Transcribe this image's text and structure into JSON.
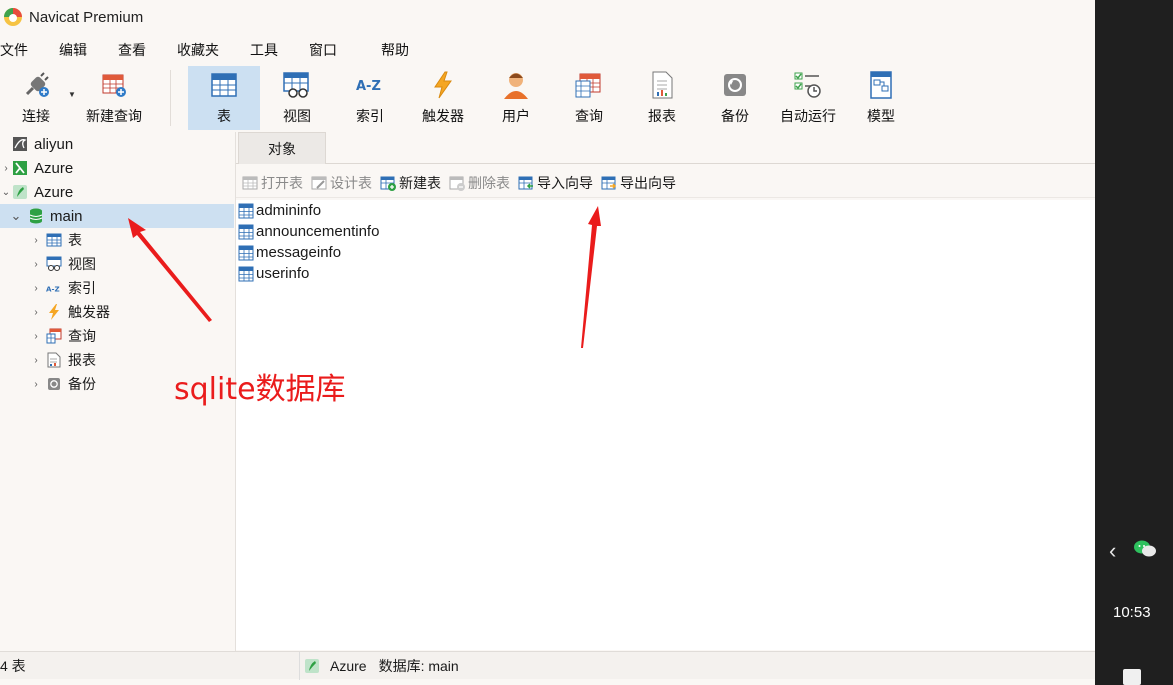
{
  "app": {
    "title": "Navicat Premium"
  },
  "menu": [
    "文件",
    "编辑",
    "查看",
    "收藏夹",
    "工具",
    "窗口",
    "帮助"
  ],
  "toolbar": {
    "connect_label": "连接",
    "new_query_label": "新建查询",
    "buttons": [
      {
        "label": "表",
        "icon": "table-icon"
      },
      {
        "label": "视图",
        "icon": "view-icon"
      },
      {
        "label": "索引",
        "icon": "index-icon"
      },
      {
        "label": "触发器",
        "icon": "trigger-icon"
      },
      {
        "label": "用户",
        "icon": "user-icon"
      },
      {
        "label": "查询",
        "icon": "query-icon"
      },
      {
        "label": "报表",
        "icon": "report-icon"
      },
      {
        "label": "备份",
        "icon": "backup-icon"
      },
      {
        "label": "自动运行",
        "icon": "automation-icon"
      },
      {
        "label": "模型",
        "icon": "model-icon"
      }
    ],
    "active_index": 0
  },
  "nav": {
    "connections": [
      {
        "label": "aliyun",
        "icon": "mysql-connection-icon"
      },
      {
        "label": "Azure",
        "icon": "sqlserver-connection-icon"
      },
      {
        "label": "Azure",
        "icon": "sqlite-connection-icon",
        "expanded": true
      }
    ],
    "database": {
      "label": "main",
      "icon": "database-icon"
    },
    "children": [
      {
        "label": "表",
        "icon": "table-icon"
      },
      {
        "label": "视图",
        "icon": "view-icon"
      },
      {
        "label": "索引",
        "icon": "index-icon"
      },
      {
        "label": "触发器",
        "icon": "trigger-icon"
      },
      {
        "label": "查询",
        "icon": "query-icon"
      },
      {
        "label": "报表",
        "icon": "report-icon"
      },
      {
        "label": "备份",
        "icon": "backup-icon"
      }
    ]
  },
  "tabs": {
    "objects": "对象"
  },
  "object_toolbar": {
    "open_table": "打开表",
    "design_table": "设计表",
    "new_table": "新建表",
    "delete_table": "删除表",
    "import_wizard": "导入向导",
    "export_wizard": "导出向导"
  },
  "objects": [
    "admininfo",
    "announcementinfo",
    "messageinfo",
    "userinfo"
  ],
  "status": {
    "count": "4 表",
    "connection": "Azure",
    "database": "数据库: main"
  },
  "annotations": {
    "sqlite_label": "sqlite数据库"
  },
  "taskbar": {
    "clock": "10:53"
  },
  "colors": {
    "accent_red": "#ea1c1c",
    "selection_blue": "#cde0f1",
    "sqlite_green": "#2ea043"
  }
}
